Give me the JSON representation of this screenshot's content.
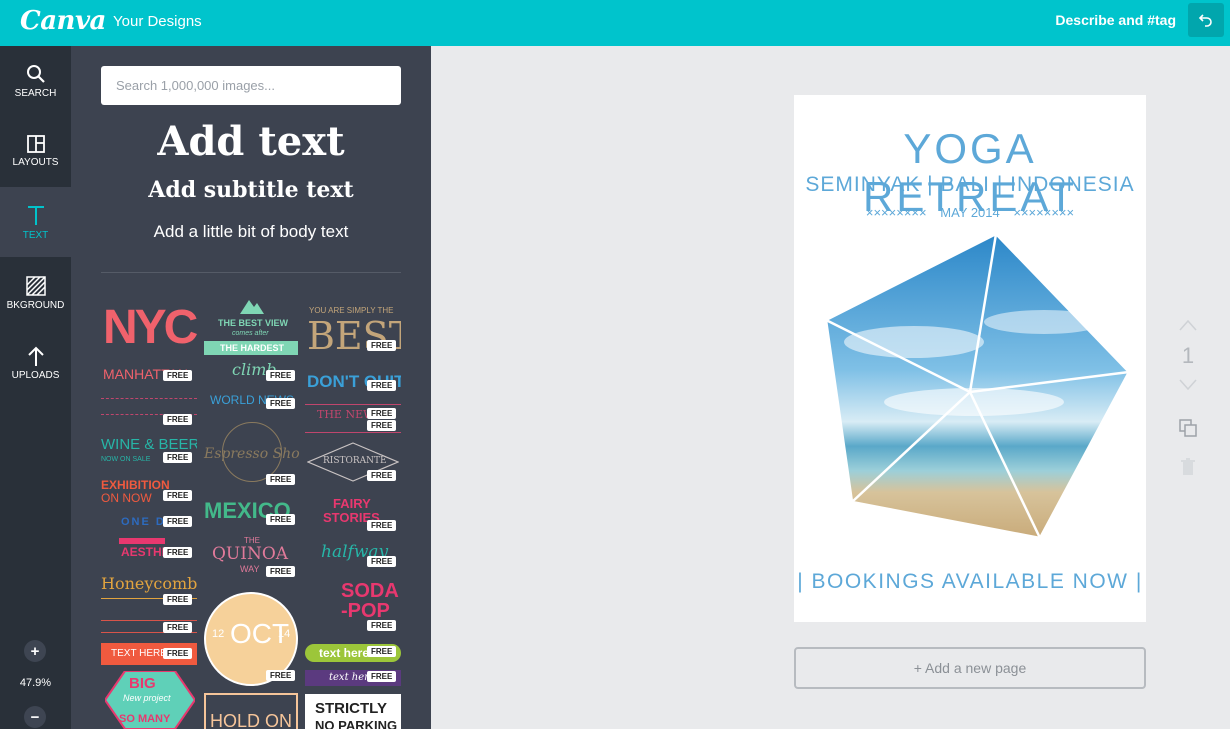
{
  "topbar": {
    "logo": "Canva",
    "your_designs": "Your Designs",
    "describe": "Describe and #tag"
  },
  "rail": {
    "search": "SEARCH",
    "layouts": "LAYOUTS",
    "text": "TEXT",
    "background": "BKGROUND",
    "uploads": "UPLOADS",
    "zoom_level": "47.9%"
  },
  "panel": {
    "search_placeholder": "Search 1,000,000 images...",
    "add_text": "Add text",
    "add_subtitle": "Add subtitle text",
    "add_body": "Add a little bit of body text",
    "badge": "FREE",
    "tiles": {
      "nyc": "NYC",
      "manhattan": "MANHATTAN",
      "best_view": "THE BEST VIEW",
      "comes_after": "comes after",
      "the_hardest": "THE HARDEST",
      "climb": "climb",
      "simply_the": "YOU ARE SIMPLY THE",
      "best": "BEST",
      "dont_quit": "DON'T QUIT",
      "world_news": "WORLD NEWS",
      "the_new": "THE NEW",
      "wine_beer": "WINE & BEER",
      "now_on_sale": "NOW ON SALE",
      "espresso": "Espresso Shot",
      "ristorante": "RISTORANTE",
      "exhibition": "EXHIBITION",
      "on_now": "ON NOW",
      "mexico": "MEXICO",
      "fairy": "FAIRY",
      "stories": "STORIES",
      "one_d": "ONE D",
      "aesthe": "AESTHE",
      "the": "THE",
      "quinoa": "QUINOA",
      "way": "WAY",
      "halfway": "halfway",
      "honeycomb": "Honeycomb",
      "soda": "SODA",
      "pop": "-POP",
      "oct": "OCT",
      "oct_12": "12",
      "oct_14": "14",
      "text_here": "TEXT HERE",
      "text_here_green": "text here",
      "text_here_purple": "text here",
      "big": "BIG",
      "new_project": "New project",
      "so_many": "SO MANY",
      "hold_on": "HOLD ON",
      "strictly": "STRICTLY",
      "no_parking": "NO PARKING"
    }
  },
  "poster": {
    "title": "YOGA RETREAT",
    "subtitle": "SEMINYAK | BALI | INDONESIA",
    "date": "MAY 2014",
    "date_left": "××××××××",
    "date_right": "××××××××",
    "footer": "| BOOKINGS AVAILABLE NOW |"
  },
  "canvas": {
    "add_page": "+ Add a new page",
    "page_number": "1"
  },
  "colors": {
    "brand": "#00c4cc",
    "rail": "#293039",
    "panel": "#3d4350",
    "poster_blue": "#5da8d8"
  }
}
